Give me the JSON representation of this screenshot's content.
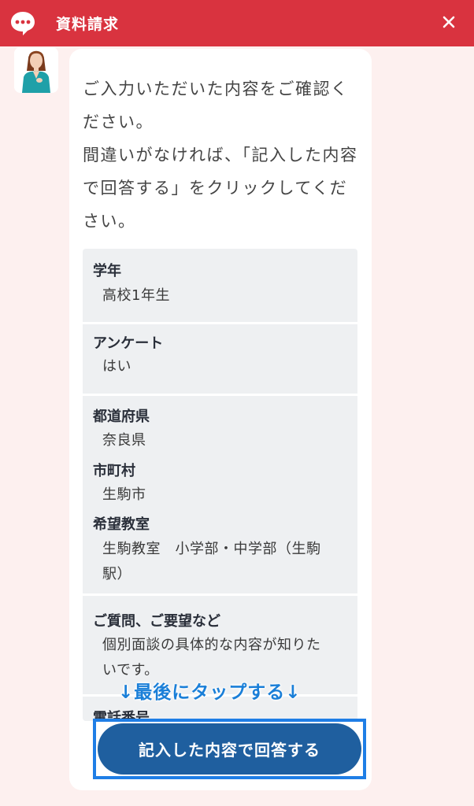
{
  "header": {
    "title": "資料請求",
    "chat_icon": "chat-bubble-icon",
    "close_icon": "close-icon",
    "color": "#d9333f"
  },
  "avatar": {
    "icon": "operator-avatar"
  },
  "message": {
    "text": "ご入力いただいた内容をご確認ください。\n間違いがなければ、「記入した内容で回答する」をクリックしてください。"
  },
  "summary": {
    "fields": [
      {
        "label": "学年",
        "value": "高校1年生"
      },
      {
        "label": "アンケート",
        "value": "はい"
      },
      {
        "label": "都道府県",
        "value": "奈良県"
      },
      {
        "label": "市町村",
        "value": "生駒市"
      },
      {
        "label": "希望教室",
        "value": "生駒教室　小学部・中学部（生駒駅）"
      },
      {
        "label": "ご質問、ご要望など",
        "value": "個別面談の具体的な内容が知りたいです。"
      },
      {
        "label": "電話番号",
        "value": ""
      }
    ]
  },
  "tap_hint": "↓最後にタップする↓",
  "submit": {
    "label": "記入した内容で回答する",
    "color": "#1f5f9f",
    "highlight": "#1f7ee6"
  }
}
